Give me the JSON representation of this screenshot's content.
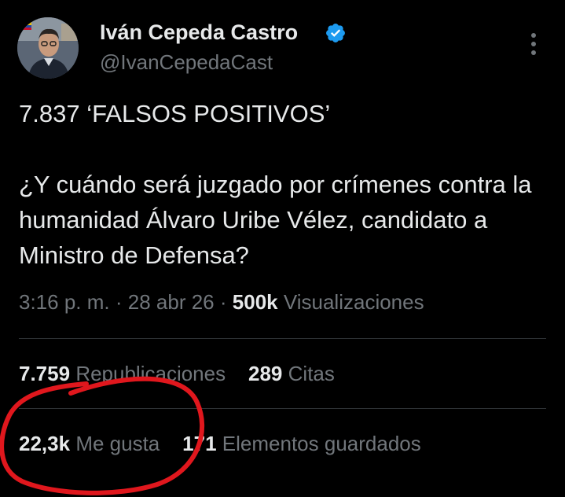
{
  "author": {
    "display_name": "Iván Cepeda Castro",
    "handle": "@IvanCepedaCast"
  },
  "tweet": {
    "line1": "7.837 ‘FALSOS POSITIVOS’",
    "line2": "¿Y cuándo será juzgado por crímenes contra la humanidad Álvaro Uribe Vélez, candidato a Ministro de Defensa?"
  },
  "meta": {
    "time": "3:16 p. m.",
    "separator": "·",
    "date": "28 abr 26",
    "views_count": "500k",
    "views_label": "Visualizaciones"
  },
  "stats": {
    "reposts_count": "7.759",
    "reposts_label": "Republicaciones",
    "quotes_count": "289",
    "quotes_label": "Citas",
    "likes_count": "22,3k",
    "likes_label": "Me gusta",
    "bookmarks_count": "171",
    "bookmarks_label": "Elementos guardados"
  },
  "colors": {
    "background": "#000000",
    "primary_text": "#e7e9ea",
    "secondary_text": "#71767b",
    "verified_badge": "#1d9bf0",
    "annotation_circle": "#e0171d"
  },
  "icons": {
    "verified": "verified-badge-icon",
    "more": "more-options-icon"
  }
}
